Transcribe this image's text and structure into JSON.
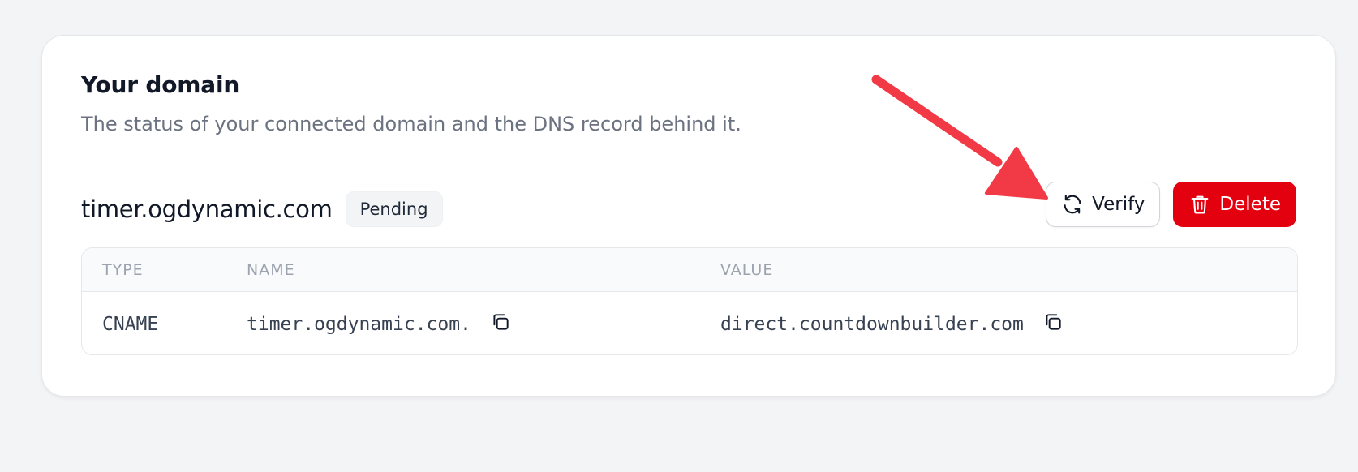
{
  "card": {
    "title": "Your domain",
    "description": "The status of your connected domain and the DNS record behind it."
  },
  "domain": {
    "name": "timer.ogdynamic.com",
    "status": "Pending"
  },
  "actions": {
    "verify_label": "Verify",
    "delete_label": "Delete"
  },
  "dns_table": {
    "headers": {
      "type": "TYPE",
      "name": "NAME",
      "value": "VALUE"
    },
    "rows": [
      {
        "type": "CNAME",
        "name": "timer.ogdynamic.com.",
        "value": "direct.countdownbuilder.com"
      }
    ]
  },
  "icons": {
    "verify": "refresh-icon",
    "delete": "trash-icon",
    "copy": "copy-icon",
    "annotation": "red-arrow-annotation"
  },
  "colors": {
    "page_bg": "#f3f4f6",
    "card_bg": "#ffffff",
    "delete_bg": "#e3000f",
    "arrow": "#f23a46",
    "muted_text": "#6b7280"
  }
}
